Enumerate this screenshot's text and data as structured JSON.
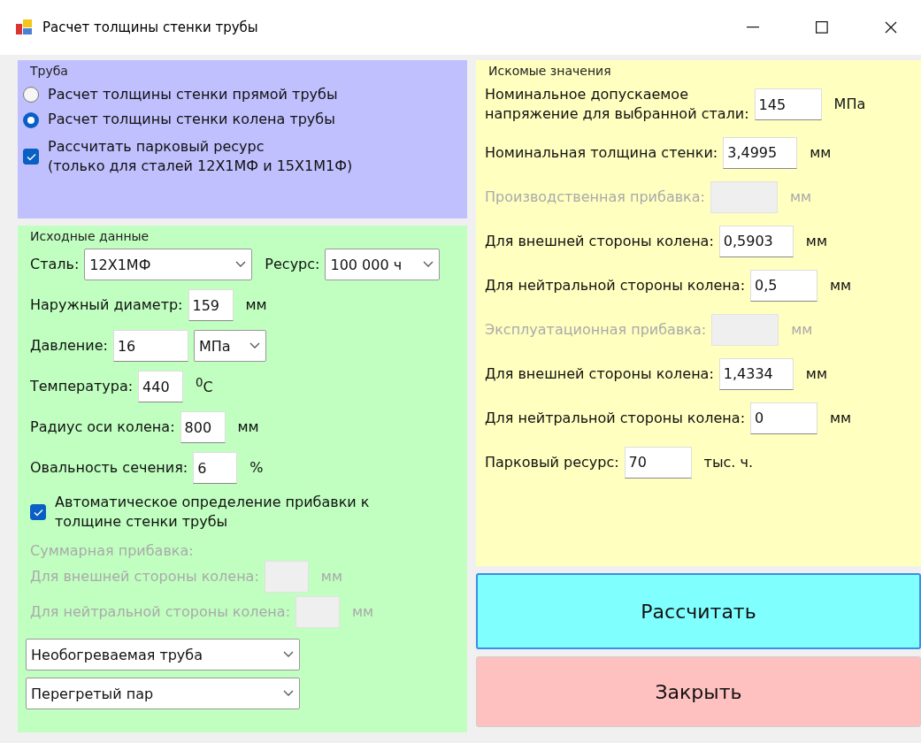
{
  "window": {
    "title": "Расчет толщины стенки трубы"
  },
  "pipe": {
    "title": "Труба",
    "modes": [
      {
        "label": "Расчет толщины стенки прямой трубы",
        "selected": false
      },
      {
        "label": "Расчет толщины стенки колена трубы",
        "selected": true
      }
    ],
    "park_resource": {
      "label": "Рассчитать парковый ресурс\n(только для сталей 12Х1МФ и 15Х1М1Ф)",
      "checked": true
    }
  },
  "inputs": {
    "title": "Исходные данные",
    "steel": {
      "label": "Сталь:",
      "value": "12Х1МФ"
    },
    "resource": {
      "label": "Ресурс:",
      "value": "100 000 ч"
    },
    "fields": [
      {
        "kind": "text",
        "label": "Наружный диаметр:",
        "value": "159",
        "unit": "мм"
      },
      {
        "kind": "text_select",
        "label": "Давление:",
        "value": "16",
        "unit": "МПа"
      },
      {
        "kind": "text",
        "label": "Температура:",
        "value": "440",
        "unit": "$^{0}$C"
      },
      {
        "kind": "text",
        "label": "Радиус оси колена:",
        "value": "800",
        "unit": "мм"
      },
      {
        "kind": "text",
        "label": "Овальность сечения:",
        "value": "6",
        "unit": "%"
      }
    ],
    "auto_allowance": {
      "label": "Автоматическое определение прибавки к\nтолщине стенки трубы",
      "checked": true
    },
    "total_allowance": {
      "title": "Суммарная прибавка:",
      "disabled": true,
      "fields": [
        {
          "label": "Для внешней стороны колена:",
          "unit": "мм"
        },
        {
          "label": "Для нейтральной стороны колена:",
          "unit": "мм"
        }
      ]
    },
    "selects": [
      {
        "value": "Необогреваемая труба"
      },
      {
        "value": "Перегретый пар"
      }
    ]
  },
  "results": {
    "title": "Искомые значения",
    "rows": [
      {
        "label": "Номинальное допускаемое\nнапряжение для выбранной стали:",
        "value": "145",
        "unit": "МПа",
        "disabled": false
      },
      {
        "label": "Номинальная толщина стенки:",
        "value": "3,4995",
        "unit": "мм",
        "disabled": false
      },
      {
        "label": "Производственная прибавка:",
        "unit": "мм",
        "disabled": true
      },
      {
        "label": "Для внешней стороны колена:",
        "value": "0,5903",
        "unit": "мм",
        "disabled": false
      },
      {
        "label": "Для нейтральной стороны колена:",
        "value": "0,5",
        "unit": "мм",
        "disabled": false
      },
      {
        "label": "Эксплуатационная прибавка:",
        "unit": "мм",
        "disabled": true
      },
      {
        "label": "Для внешней стороны колена:",
        "value": "1,4334",
        "unit": "мм",
        "disabled": false
      },
      {
        "label": "Для нейтральной стороны колена:",
        "value": "0",
        "unit": "мм",
        "disabled": false
      },
      {
        "label": "Парковый ресурс:",
        "value": "70",
        "unit": "тыс. ч.",
        "disabled": false
      }
    ]
  },
  "buttons": [
    {
      "kind": "calculate",
      "label": "Рассчитать"
    },
    {
      "kind": "close",
      "label": "Закрыть"
    }
  ]
}
